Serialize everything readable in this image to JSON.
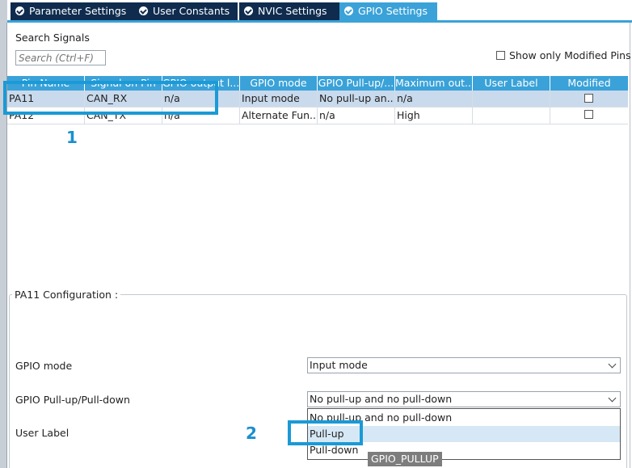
{
  "tabs": [
    {
      "label": "Parameter Settings"
    },
    {
      "label": "User Constants"
    },
    {
      "label": "NVIC Settings"
    },
    {
      "label": "GPIO Settings",
      "active": true
    }
  ],
  "search": {
    "label": "Search Signals",
    "placeholder": "Search (Ctrl+F)"
  },
  "show_modified": {
    "label": "Show only Modified Pins",
    "checked": false
  },
  "table": {
    "columns": [
      "Pin Name",
      "Signal on Pin",
      "GPIO output l...",
      "GPIO mode",
      "GPIO Pull-up/...",
      "Maximum out...",
      "User Label",
      "Modified"
    ],
    "rows": [
      {
        "pin": "PA11",
        "signal": "CAN_RX",
        "output": "n/a",
        "mode": "Input mode",
        "pull": "No pull-up an...",
        "speed": "n/a",
        "label": "",
        "modified": false
      },
      {
        "pin": "PA12",
        "signal": "CAN_TX",
        "output": "n/a",
        "mode": "Alternate Fun...",
        "pull": "n/a",
        "speed": "High",
        "label": "",
        "modified": false
      }
    ]
  },
  "config": {
    "title": "PA11 Configuration :",
    "gpio_mode": {
      "label": "GPIO mode",
      "value": "Input mode"
    },
    "pull": {
      "label": "GPIO Pull-up/Pull-down",
      "value": "No pull-up and no pull-down"
    },
    "user_label": {
      "label": "User Label"
    },
    "dropdown_options": [
      "No pull-up and no pull-down",
      "Pull-up",
      "Pull-down"
    ],
    "tooltip": "GPIO_PULLUP"
  },
  "annotations": [
    "1",
    "2"
  ],
  "colors": {
    "accent": "#3aa2d8",
    "tab_dark": "#0f2c4f",
    "highlight": "#1a9ad6",
    "selected_row": "#c9daed"
  }
}
